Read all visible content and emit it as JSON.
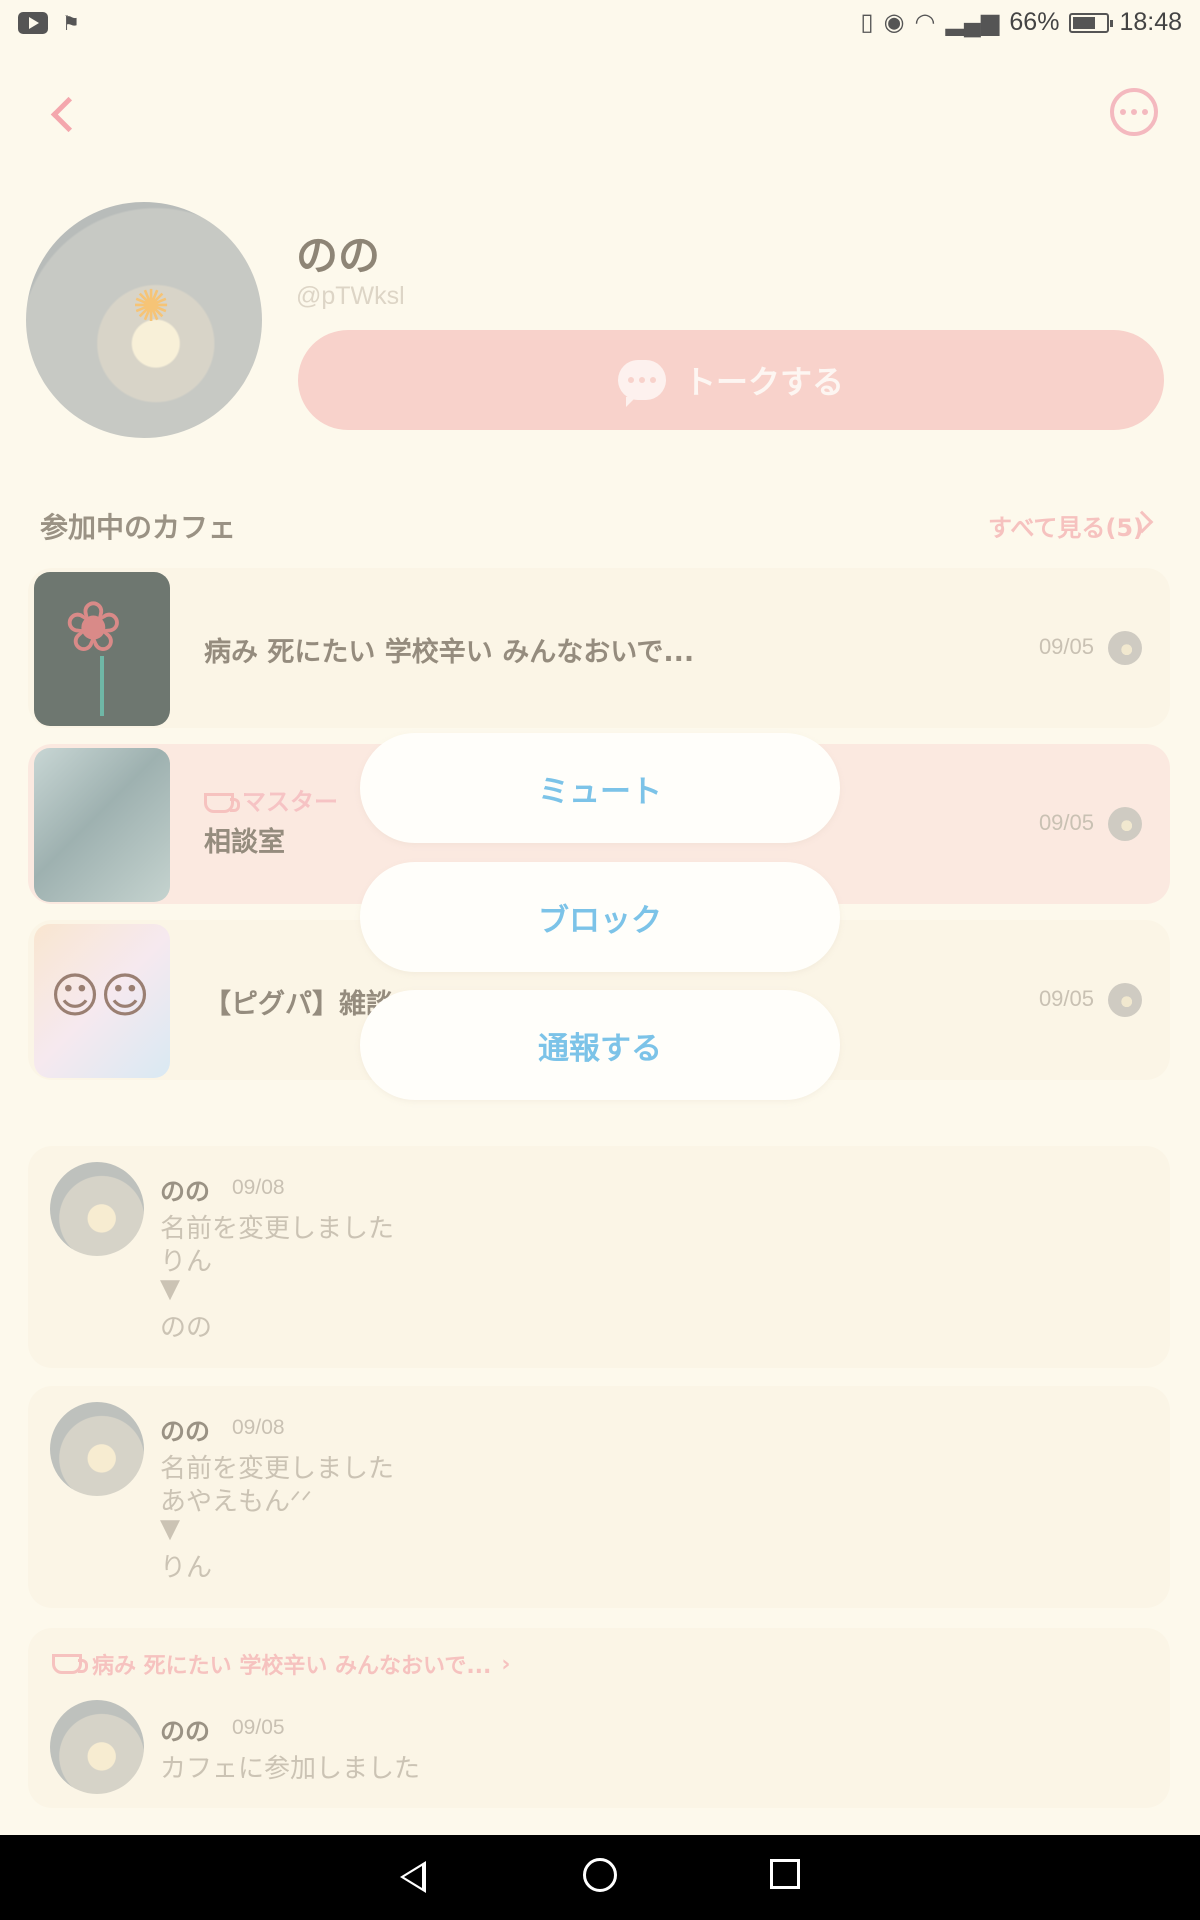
{
  "status_bar": {
    "battery_percent": "66%",
    "time": "18:48",
    "icons": [
      "youtube-icon",
      "app-icon",
      "vibrate-icon",
      "eye-icon",
      "wifi-icon",
      "signal-icon",
      "battery-icon"
    ]
  },
  "nav": {
    "back_icon": "chevron-left-icon",
    "more_icon": "more-horizontal-icon"
  },
  "profile": {
    "name": "のの",
    "handle": "@pTWksl",
    "talk_button": "トークする"
  },
  "cafes": {
    "section_title": "参加中のカフェ",
    "see_all": "すべて見る(5)",
    "items": [
      {
        "title": "病み 死にたい 学校辛い みんなおいで...",
        "date": "09/05"
      },
      {
        "badge": "マスター",
        "title": "相談室",
        "date": "09/05"
      },
      {
        "title": "【ピグパ】雑談",
        "date": "09/05"
      }
    ]
  },
  "timeline": [
    {
      "name": "のの",
      "date": "09/08",
      "lines": [
        "名前を変更しました",
        "りん",
        "▼",
        "のの"
      ]
    },
    {
      "name": "のの",
      "date": "09/08",
      "lines": [
        "名前を変更しました",
        "あやえもんᐟᐟ",
        "▼",
        "りん"
      ]
    },
    {
      "cafe_link": "病み 死にたい 学校辛い みんなおいで...",
      "name": "のの",
      "date": "09/05",
      "lines": [
        "カフェに参加しました"
      ]
    }
  ],
  "menu": {
    "mute": "ミュート",
    "block": "ブロック",
    "report": "通報する"
  },
  "colors": {
    "background": "#fdf9ec",
    "accent_pink": "#f8d2cb",
    "menu_text_blue": "#7cc3e8"
  }
}
